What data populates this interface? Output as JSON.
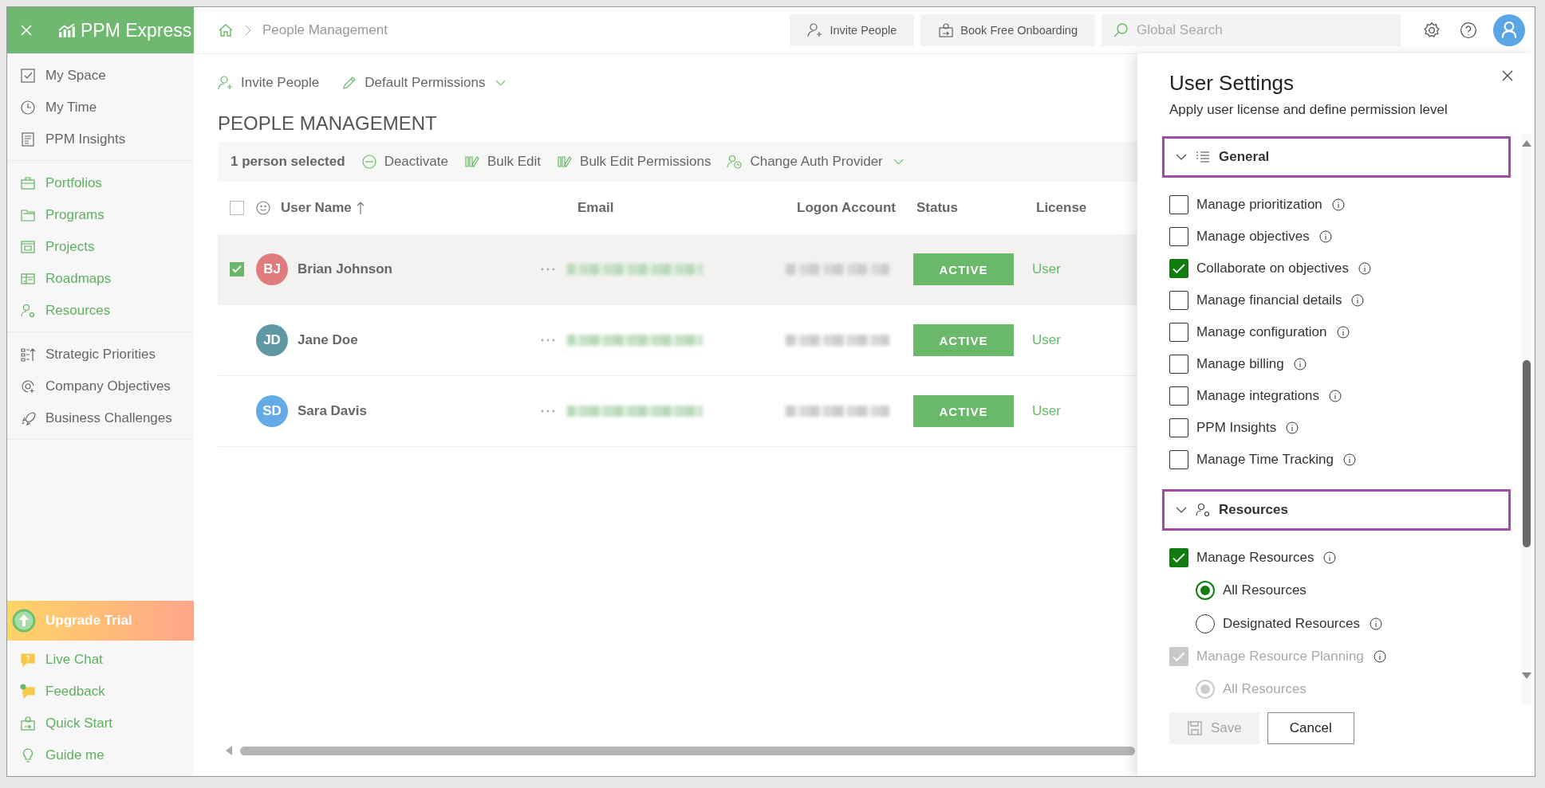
{
  "sidebar": {
    "logo": "**PPM** Express",
    "groups": [
      {
        "kind": "plain",
        "items": [
          "My Space",
          "My Time",
          "PPM Insights"
        ]
      },
      {
        "kind": "module",
        "items": [
          "Portfolios",
          "Programs",
          "Projects",
          "Roadmaps",
          "Resources"
        ]
      },
      {
        "kind": "plain",
        "items": [
          "Strategic Priorities",
          "Company Objectives",
          "Business Challenges"
        ]
      }
    ],
    "upgrade": "Upgrade Trial",
    "help_items": [
      "Live Chat",
      "Feedback",
      "Quick Start",
      "Guide me"
    ]
  },
  "top_bar": {
    "breadcrumb": "People Management",
    "buttons": [
      "Invite People",
      "Book Free Onboarding"
    ],
    "search": {
      "placeholder": "Global Search"
    }
  },
  "toolbar": {
    "actions": [
      {
        "label": "Invite People",
        "dropdown": false
      },
      {
        "label": "Default Permissions",
        "dropdown": true
      }
    ]
  },
  "page_title": "PEOPLE MANAGEMENT",
  "selection_bar": {
    "count": "1 person selected",
    "actions": [
      {
        "label": "Deactivate",
        "dropdown": false
      },
      {
        "label": "Bulk Edit",
        "dropdown": false
      },
      {
        "label": "Bulk Edit Permissions",
        "dropdown": false
      },
      {
        "label": "Change Auth Provider",
        "dropdown": true
      }
    ]
  },
  "table": {
    "all_checked": false,
    "columns": [
      {
        "label": "User Name",
        "sorted": true
      },
      {
        "label": "Email",
        "sorted": false
      },
      {
        "label": "Logon Account",
        "sorted": false
      },
      {
        "label": "Status",
        "sorted": false
      },
      {
        "label": "License",
        "sorted": false
      }
    ],
    "rows": [
      {
        "initials": "BJ",
        "name": "Brian Johnson",
        "color": "#e07b7e",
        "selected": true,
        "status": "ACTIVE",
        "license": "User"
      },
      {
        "initials": "JD",
        "name": "Jane Doe",
        "color": "#5f97a3",
        "selected": false,
        "status": "ACTIVE",
        "license": "User"
      },
      {
        "initials": "SD",
        "name": "Sara Davis",
        "color": "#64aae6",
        "selected": false,
        "status": "ACTIVE",
        "license": "User"
      }
    ]
  },
  "panel": {
    "title": "User Settings",
    "subtitle": "Apply user license and define permission level",
    "sections": [
      {
        "title": "General",
        "kind": "list",
        "expanded": true,
        "items": [
          {
            "kind": "checkbox",
            "label": "Manage prioritization",
            "checked": false,
            "disabled": false,
            "info": true
          },
          {
            "kind": "checkbox",
            "label": "Manage objectives",
            "checked": false,
            "disabled": false,
            "info": true
          },
          {
            "kind": "checkbox",
            "label": "Collaborate on objectives",
            "checked": true,
            "disabled": false,
            "info": true
          },
          {
            "kind": "checkbox",
            "label": "Manage financial details",
            "checked": false,
            "disabled": false,
            "info": true
          },
          {
            "kind": "checkbox",
            "label": "Manage configuration",
            "checked": false,
            "disabled": false,
            "info": true
          },
          {
            "kind": "checkbox",
            "label": "Manage billing",
            "checked": false,
            "disabled": false,
            "info": true
          },
          {
            "kind": "checkbox",
            "label": "Manage integrations",
            "checked": false,
            "disabled": false,
            "info": true
          },
          {
            "kind": "checkbox",
            "label": "PPM Insights",
            "checked": false,
            "disabled": false,
            "info": true
          },
          {
            "kind": "checkbox",
            "label": "Manage Time Tracking",
            "checked": false,
            "disabled": false,
            "info": true
          }
        ]
      },
      {
        "title": "Resources",
        "kind": "resources",
        "expanded": true,
        "items": [
          {
            "kind": "checkbox",
            "label": "Manage Resources",
            "checked": true,
            "disabled": false,
            "info": true
          },
          {
            "kind": "radio",
            "label": "All Resources",
            "selected": true,
            "disabled": false,
            "info": false
          },
          {
            "kind": "radio",
            "label": "Designated Resources",
            "selected": false,
            "disabled": false,
            "info": true
          },
          {
            "kind": "checkbox",
            "label": "Manage Resource Planning",
            "checked": true,
            "disabled": true,
            "info": true
          },
          {
            "kind": "radio",
            "label": "All Resources",
            "selected": true,
            "disabled": true,
            "info": false
          }
        ]
      }
    ],
    "buttons": [
      {
        "label": "Save",
        "disabled": true,
        "kind": "save"
      },
      {
        "label": "Cancel",
        "disabled": false,
        "kind": "cancel"
      }
    ]
  }
}
